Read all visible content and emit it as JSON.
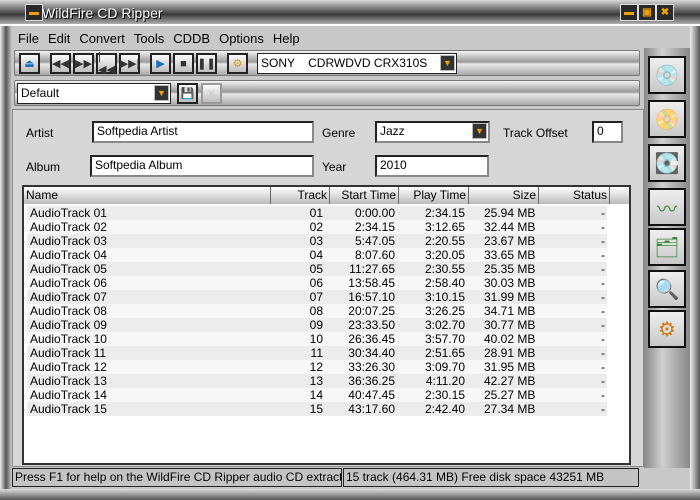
{
  "window": {
    "title": "WildFire CD Ripper"
  },
  "menu": [
    "File",
    "Edit",
    "Convert",
    "Tools",
    "CDDB",
    "Options",
    "Help"
  ],
  "toolbar": {
    "drive": "SONY    CDRWDVD CRX310S"
  },
  "preset": {
    "value": "Default"
  },
  "fields": {
    "artist_label": "Artist",
    "artist": "Softpedia Artist",
    "album_label": "Album",
    "album": "Softpedia Album",
    "genre_label": "Genre",
    "genre": "Jazz",
    "year_label": "Year",
    "year": "2010",
    "offset_label": "Track Offset",
    "offset": "0"
  },
  "table": {
    "columns": [
      "Name",
      "Track",
      "Start Time",
      "Play Time",
      "Size",
      "Status"
    ],
    "rows": [
      [
        "AudioTrack 01",
        "01",
        "0:00.00",
        "2:34.15",
        "25.94 MB",
        "-"
      ],
      [
        "AudioTrack 02",
        "02",
        "2:34.15",
        "3:12.65",
        "32.44 MB",
        "-"
      ],
      [
        "AudioTrack 03",
        "03",
        "5:47.05",
        "2:20.55",
        "23.67 MB",
        "-"
      ],
      [
        "AudioTrack 04",
        "04",
        "8:07.60",
        "3:20.05",
        "33.65 MB",
        "-"
      ],
      [
        "AudioTrack 05",
        "05",
        "11:27.65",
        "2:30.55",
        "25.35 MB",
        "-"
      ],
      [
        "AudioTrack 06",
        "06",
        "13:58.45",
        "2:58.40",
        "30.03 MB",
        "-"
      ],
      [
        "AudioTrack 07",
        "07",
        "16:57.10",
        "3:10.15",
        "31.99 MB",
        "-"
      ],
      [
        "AudioTrack 08",
        "08",
        "20:07.25",
        "3:26.25",
        "34.71 MB",
        "-"
      ],
      [
        "AudioTrack 09",
        "09",
        "23:33.50",
        "3:02.70",
        "30.77 MB",
        "-"
      ],
      [
        "AudioTrack 10",
        "10",
        "26:36.45",
        "3:57.70",
        "40.02 MB",
        "-"
      ],
      [
        "AudioTrack 11",
        "11",
        "30:34.40",
        "2:51.65",
        "28.91 MB",
        "-"
      ],
      [
        "AudioTrack 12",
        "12",
        "33:26.30",
        "3:09.70",
        "31.95 MB",
        "-"
      ],
      [
        "AudioTrack 13",
        "13",
        "36:36.25",
        "4:11.20",
        "42.27 MB",
        "-"
      ],
      [
        "AudioTrack 14",
        "14",
        "40:47.45",
        "2:30.15",
        "25.27 MB",
        "-"
      ],
      [
        "AudioTrack 15",
        "15",
        "43:17.60",
        "2:42.40",
        "27.34 MB",
        "-"
      ]
    ]
  },
  "status": {
    "help": "Press F1 for help on the WildFire CD Ripper audio CD extract...",
    "info": "15 track (464.31 MB) Free disk space 43251 MB"
  }
}
